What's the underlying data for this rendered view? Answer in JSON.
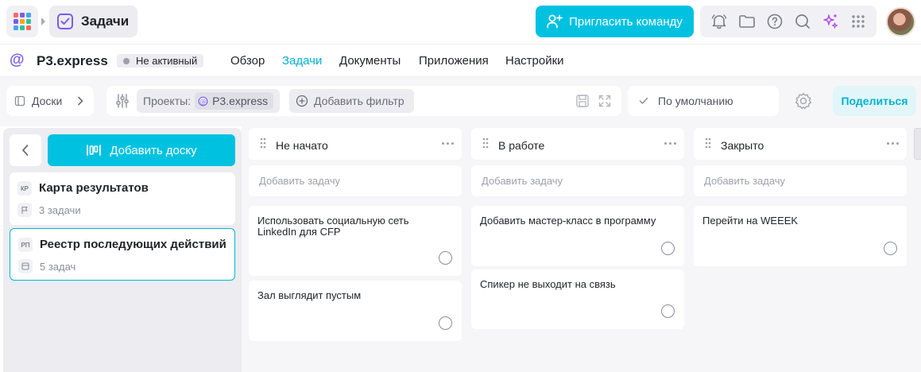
{
  "header": {
    "app_title": "Задачи",
    "invite_label": "Пригласить команду",
    "icons": [
      "apps-grid-icon",
      "bell-icon",
      "folder-icon",
      "help-icon",
      "search-icon",
      "sparkle-icon",
      "grid-icon"
    ],
    "apps_colors": [
      "#f06a6a",
      "#7c5ce6",
      "#4aa3f0",
      "#7c5ce6",
      "#f5a623",
      "#35c18f",
      "#4aa3f0",
      "#35c18f",
      "#f06a6a"
    ]
  },
  "project": {
    "name": "P3.express",
    "status": "Не активный",
    "nav": [
      {
        "label": "Обзор",
        "active": false
      },
      {
        "label": "Задачи",
        "active": true
      },
      {
        "label": "Документы",
        "active": false
      },
      {
        "label": "Приложения",
        "active": false
      },
      {
        "label": "Настройки",
        "active": false
      }
    ]
  },
  "filterbar": {
    "boards_label": "Доски",
    "projects_label": "Проекты:",
    "project_chip": "P3.express",
    "add_filter_label": "Добавить фильтр",
    "default_label": "По умолчанию",
    "share_label": "Поделиться"
  },
  "sidebar": {
    "add_board_label": "Добавить доску",
    "boards": [
      {
        "abbr": "КР",
        "title": "Карта результатов",
        "count": "3 задачи",
        "selected": false
      },
      {
        "abbr": "РП",
        "title": "Реестр последующих действий",
        "count": "5 задач",
        "selected": true
      }
    ]
  },
  "kanban": {
    "add_task_placeholder": "Добавить задачу",
    "columns": [
      {
        "title": "Не начато",
        "tasks": [
          "Использовать социальную сеть LinkedIn для CFP",
          "Зал выглядит пустым"
        ]
      },
      {
        "title": "В работе",
        "tasks": [
          "Добавить мастер-класс в программу",
          "Спикер не выходит на связь"
        ]
      },
      {
        "title": "Закрыто",
        "tasks": [
          "Перейти на WEEEK"
        ]
      }
    ]
  },
  "colors": {
    "accent": "#00c2e0",
    "brand_purple": "#7c5ce6",
    "active_nav": "#00b3cf"
  }
}
